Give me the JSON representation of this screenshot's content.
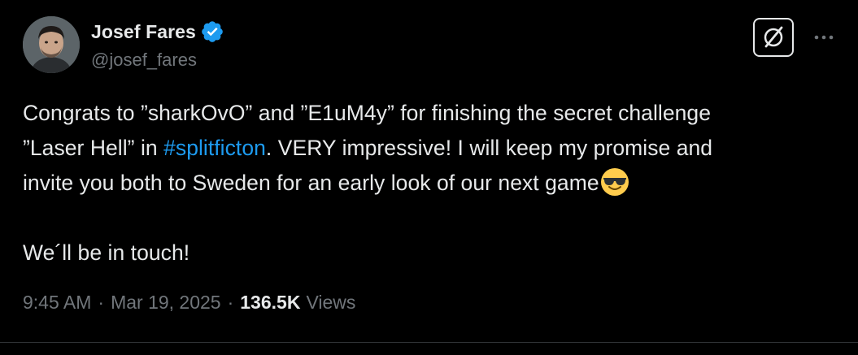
{
  "author": {
    "name": "Josef Fares",
    "handle": "@josef_fares",
    "verified": true
  },
  "tweet": {
    "line1": "Congrats to ”sharkOvO” and ”E1uM4y” for finishing the secret challenge",
    "line2_before": "”Laser Hell” in ",
    "hashtag": "#splitficton",
    "line2_after": ". VERY impressive! I will keep my promise and",
    "line3": "invite you both to Sweden for an early look of our next game",
    "emoji": "smiling-face-with-sunglasses",
    "line4": "We´ll be in touch!"
  },
  "meta": {
    "time": "9:45 AM",
    "separator1": "·",
    "date": "Mar 19, 2025",
    "separator2": "·",
    "views_count": "136.5K",
    "views_label": "Views"
  },
  "icons": {
    "verified": "verified-badge-icon",
    "grok": "grok-icon",
    "more": "more-dots-icon"
  },
  "colors": {
    "background": "#000000",
    "text": "#e7e9ea",
    "secondary": "#71767b",
    "link": "#1d9bf0",
    "verified": "#1d9bf0"
  }
}
